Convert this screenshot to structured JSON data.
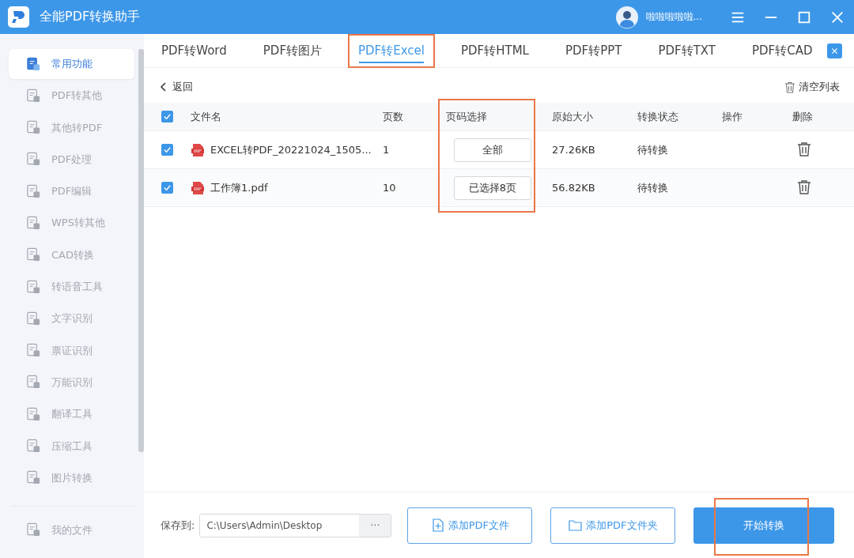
{
  "window": {
    "title": "全能PDF转换助手",
    "user": "啦啦啦啦啦..."
  },
  "sidebar": {
    "items": [
      {
        "label": "常用功能",
        "selected": true
      },
      {
        "label": "PDF转其他",
        "selected": false
      },
      {
        "label": "其他转PDF",
        "selected": false
      },
      {
        "label": "PDF处理",
        "selected": false
      },
      {
        "label": "PDF编辑",
        "selected": false
      },
      {
        "label": "WPS转其他",
        "selected": false
      },
      {
        "label": "CAD转换",
        "selected": false
      },
      {
        "label": "转语音工具",
        "selected": false
      },
      {
        "label": "文字识别",
        "selected": false
      },
      {
        "label": "票证识别",
        "selected": false
      },
      {
        "label": "万能识别",
        "selected": false
      },
      {
        "label": "翻译工具",
        "selected": false
      },
      {
        "label": "压缩工具",
        "selected": false
      },
      {
        "label": "图片转换",
        "selected": false
      }
    ],
    "footer_item": {
      "label": "我的文件",
      "selected": false
    }
  },
  "tabs": [
    {
      "label": "PDF转Word",
      "selected": false,
      "highlighted": false
    },
    {
      "label": "PDF转图片",
      "selected": false,
      "highlighted": false
    },
    {
      "label": "PDF转Excel",
      "selected": true,
      "highlighted": true
    },
    {
      "label": "PDF转HTML",
      "selected": false,
      "highlighted": false
    },
    {
      "label": "PDF转PPT",
      "selected": false,
      "highlighted": false
    },
    {
      "label": "PDF转TXT",
      "selected": false,
      "highlighted": false
    },
    {
      "label": "PDF转CAD",
      "selected": false,
      "highlighted": false
    }
  ],
  "back": "返回",
  "clear_list": "清空列表",
  "table": {
    "all_checked": true,
    "columns": [
      {
        "label": "文件名",
        "highlighted": false
      },
      {
        "label": "页数",
        "highlighted": false
      },
      {
        "label": "页码选择",
        "highlighted": true
      },
      {
        "label": "原始大小",
        "highlighted": false
      },
      {
        "label": "转换状态",
        "highlighted": false
      },
      {
        "label": "操作",
        "highlighted": false
      },
      {
        "label": "删除",
        "highlighted": false
      }
    ],
    "rows": [
      {
        "checked": true,
        "name": "EXCEL转PDF_20221024_1505...",
        "pages": "1",
        "page_select": "全部",
        "size": "27.26KB",
        "status": "待转换"
      },
      {
        "checked": true,
        "name": "工作簿1.pdf",
        "pages": "10",
        "page_select": "已选择8页",
        "size": "56.82KB",
        "status": "待转换"
      }
    ]
  },
  "footer": {
    "save_label": "保存到:",
    "save_path": "C:\\Users\\Admin\\Desktop",
    "browse": "···",
    "buttons": [
      {
        "kind": "file",
        "label": "添加PDF文件",
        "highlighted": false
      },
      {
        "kind": "folder",
        "label": "添加PDF文件夹",
        "highlighted": false
      },
      {
        "kind": "primary",
        "label": "开始转换",
        "highlighted": true
      }
    ]
  }
}
